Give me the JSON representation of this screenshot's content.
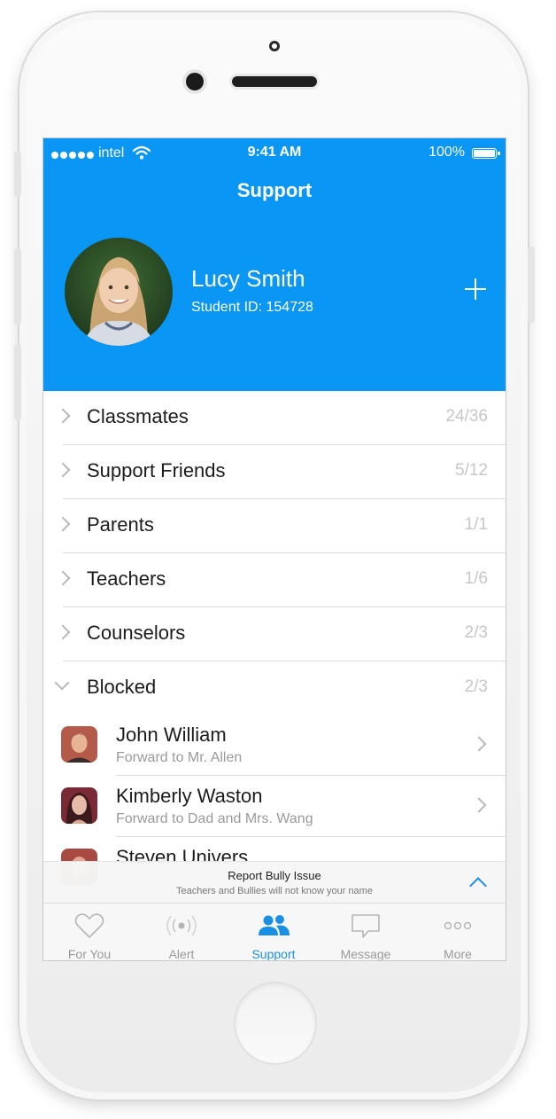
{
  "status_bar": {
    "carrier": "intel",
    "time": "9:41 AM",
    "battery": "100%"
  },
  "header": {
    "title": "Support"
  },
  "profile": {
    "name": "Lucy Smith",
    "student_id": "Student ID: 154728"
  },
  "groups": [
    {
      "label": "Classmates",
      "count": "24/36",
      "expanded": false
    },
    {
      "label": "Support Friends",
      "count": "5/12",
      "expanded": false
    },
    {
      "label": "Parents",
      "count": "1/1",
      "expanded": false
    },
    {
      "label": "Teachers",
      "count": "1/6",
      "expanded": false
    },
    {
      "label": "Counselors",
      "count": "2/3",
      "expanded": false
    },
    {
      "label": "Blocked",
      "count": "2/3",
      "expanded": true
    }
  ],
  "blocked_people": [
    {
      "name": "John William",
      "note": "Forward to Mr. Allen"
    },
    {
      "name": "Kimberly Waston",
      "note": "Forward to Dad and Mrs. Wang"
    },
    {
      "name": "Steven Univers",
      "note": ""
    }
  ],
  "report": {
    "title": "Report Bully Issue",
    "subtitle": "Teachers and Bullies will not know your name"
  },
  "tabs": [
    {
      "label": "For You",
      "icon": "heart-icon",
      "active": false
    },
    {
      "label": "Alert",
      "icon": "broadcast-icon",
      "active": false
    },
    {
      "label": "Support",
      "icon": "people-icon",
      "active": true
    },
    {
      "label": "Message",
      "icon": "chat-bubble-icon",
      "active": false
    },
    {
      "label": "More",
      "icon": "more-dots-icon",
      "active": false
    }
  ],
  "colors": {
    "accent": "#0a96f5",
    "tab_active": "#1a8fe6",
    "count_text": "#c7c7c7"
  }
}
